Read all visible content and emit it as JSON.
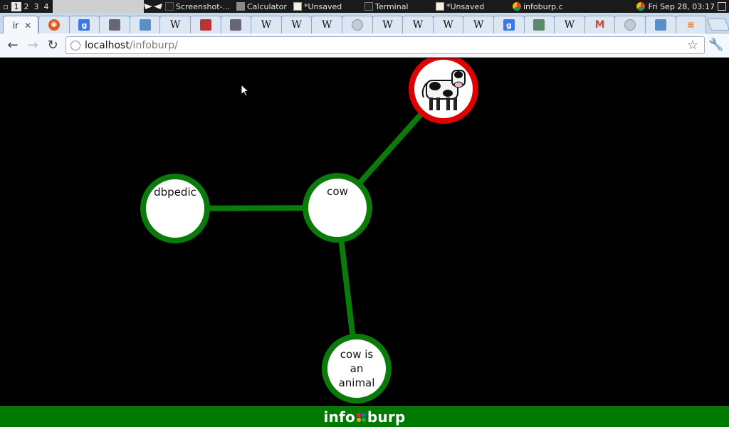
{
  "os_panel": {
    "workspaces": [
      "1",
      "2",
      "3",
      "4"
    ],
    "active_workspace": "1",
    "windows": [
      {
        "label": "Screenshot-...",
        "icon": "screenshot-icon"
      },
      {
        "label": "Calculator",
        "icon": "calculator-icon"
      },
      {
        "label": "*Unsaved",
        "icon": "text-editor-icon"
      },
      {
        "label": "Terminal",
        "icon": "terminal-icon"
      },
      {
        "label": "*Unsaved",
        "icon": "text-editor-icon"
      },
      {
        "label": "infoburp.c",
        "icon": "chrome-icon"
      }
    ],
    "clock": "Fri Sep 28, 03:17"
  },
  "browser": {
    "active_tab": {
      "label": "ir"
    },
    "tab_icons": [
      "ubuntu-icon",
      "google-icon",
      "document-icon",
      "image-icon",
      "wikipedia-icon",
      "slides-icon",
      "document-icon",
      "wikipedia-icon",
      "wikipedia-icon",
      "wikipedia-icon",
      "globe-icon",
      "wikipedia-icon",
      "wikipedia-icon",
      "wikipedia-icon",
      "wikipedia-icon",
      "google-icon",
      "map-icon",
      "wikipedia-icon",
      "gmail-icon",
      "globe-icon",
      "chat-icon",
      "stackoverflow-icon"
    ],
    "address": {
      "host": "localhost",
      "path": "/infoburp/"
    }
  },
  "graph": {
    "nodes": [
      {
        "id": "dbpedia",
        "label": "dbpedic",
        "border": "green"
      },
      {
        "id": "cow",
        "label": "cow",
        "border": "green"
      },
      {
        "id": "cow_image",
        "label": "",
        "border": "red",
        "image": "cow-image"
      },
      {
        "id": "cow_is_an_animal",
        "label_lines": [
          "cow is",
          "an",
          "animal"
        ],
        "border": "green"
      }
    ],
    "edges": [
      {
        "from": "dbpedia",
        "to": "cow"
      },
      {
        "from": "cow",
        "to": "cow_image"
      },
      {
        "from": "cow",
        "to": "cow_is_an_animal"
      }
    ]
  },
  "footer": {
    "brand_left": "info",
    "brand_right": "burp"
  },
  "colors": {
    "edge_green": "#0a7a0a",
    "node_fill": "#ffffff",
    "node_red": "#e00000",
    "footer_bg": "#007a00"
  }
}
